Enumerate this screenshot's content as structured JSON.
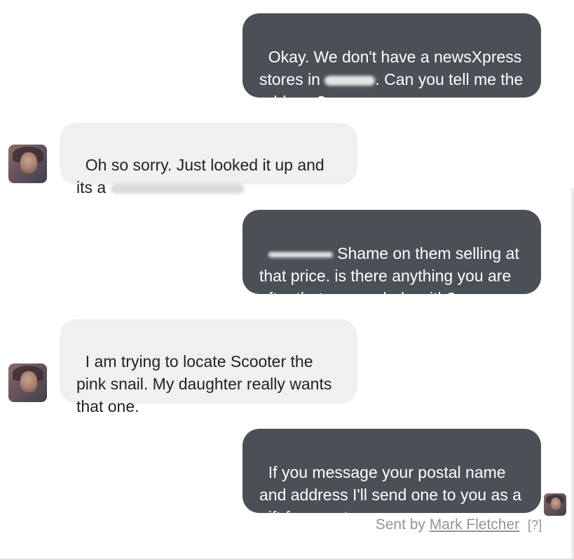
{
  "conversation": {
    "messages": [
      {
        "direction": "outgoing",
        "text_a": "Okay. We don't have a newsXpress stores in ",
        "text_b": ". Can you tell me the address?"
      },
      {
        "direction": "incoming",
        "text_a": "Oh so sorry. Just looked it up and its a "
      },
      {
        "direction": "outgoing",
        "text_a": " Shame on them selling at that price. is there anything you are after that we can help with?"
      },
      {
        "direction": "incoming",
        "text_a": "I am trying to locate Scooter the pink snail. My daughter really wants that one."
      },
      {
        "direction": "outgoing",
        "text_a": "If you message your postal name and address I'll send one to you as a gift from us to you."
      }
    ],
    "sent_by": {
      "prefix": "Sent by",
      "author": "Mark Fletcher",
      "help": "[?]"
    }
  },
  "colors": {
    "outgoing_bubble": "#4b4f56",
    "incoming_bubble": "#f1f0f0",
    "meta_text": "#90949c"
  },
  "icons": {
    "contact_avatar": "avatar-photo",
    "seen_avatar": "avatar-photo"
  }
}
